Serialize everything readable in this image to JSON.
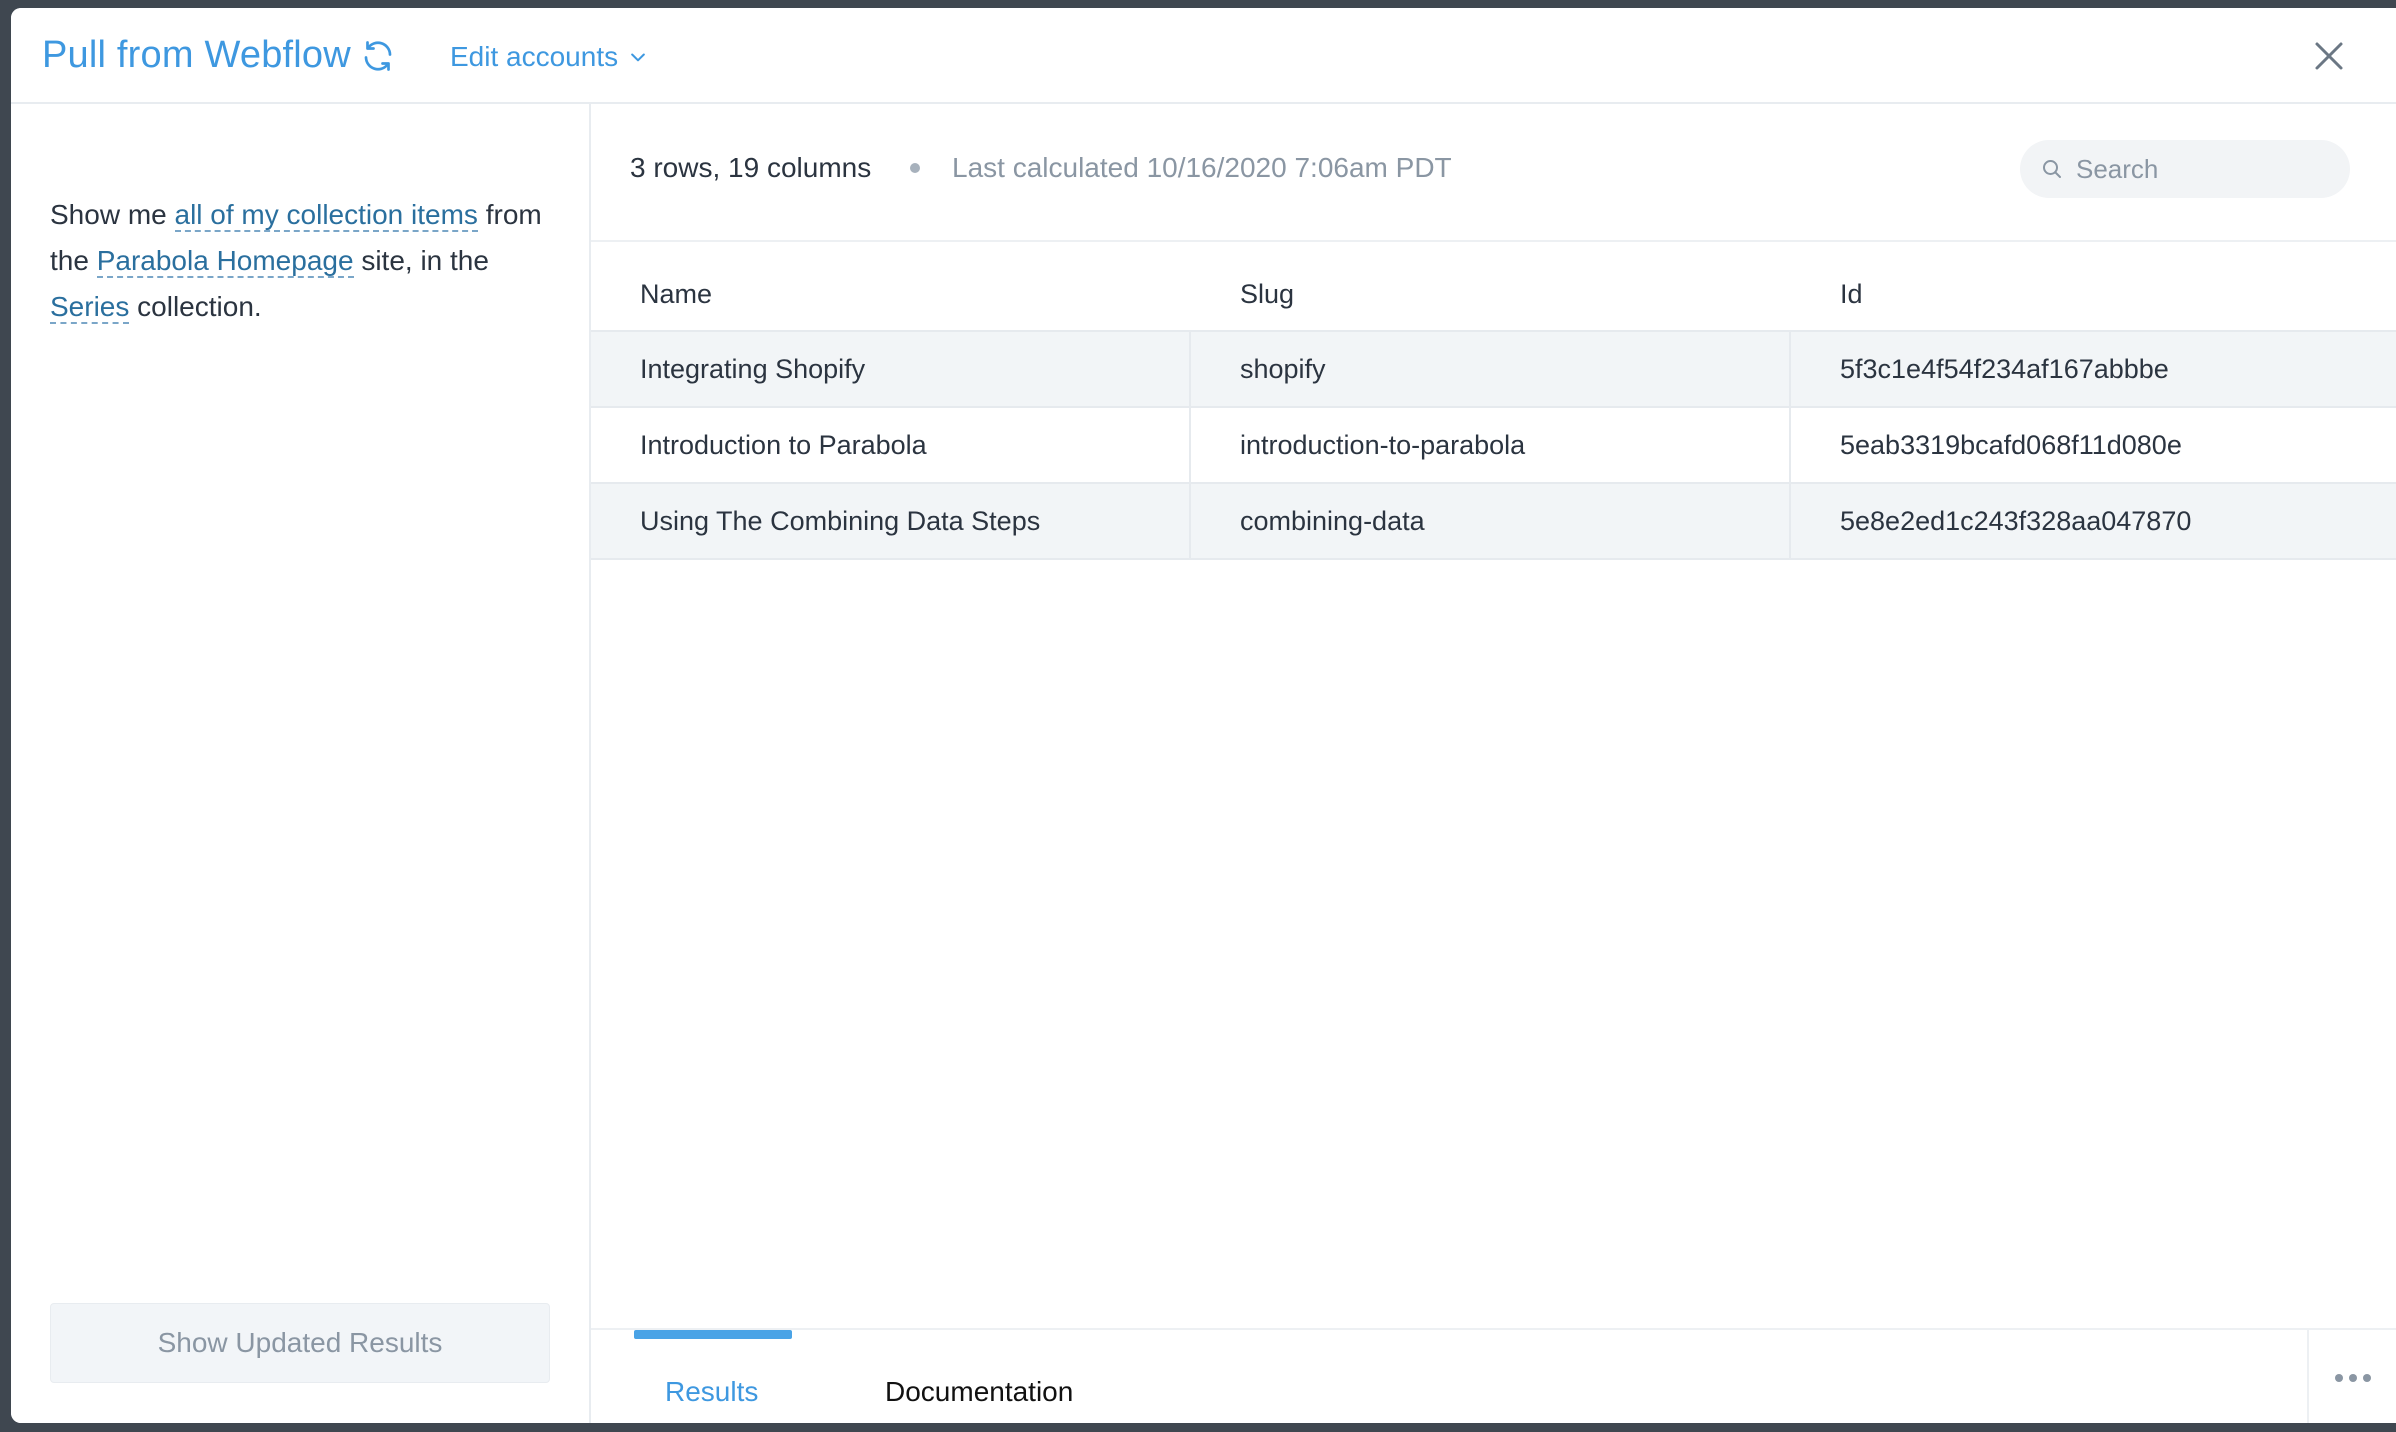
{
  "header": {
    "title": "Pull from Webflow",
    "edit_accounts_label": "Edit accounts"
  },
  "left": {
    "sentence": {
      "p1": "Show me ",
      "link1": "all of my collection items",
      "p2": " from the ",
      "link2": "Parabola Homepage",
      "p3": " site, in the ",
      "link3": "Series",
      "p4": " collection."
    },
    "show_updated_label": "Show Updated Results"
  },
  "summary": {
    "rows_cols": "3 rows, 19 columns",
    "last_calculated": "Last calculated 10/16/2020 7:06am PDT"
  },
  "search": {
    "placeholder": "Search",
    "value": ""
  },
  "table": {
    "columns": [
      "Name",
      "Slug",
      "Id"
    ],
    "rows": [
      [
        "Integrating Shopify",
        "shopify",
        "5f3c1e4f54f234af167abbbe"
      ],
      [
        "Introduction to Parabola",
        "introduction-to-parabola",
        "5eab3319bcafd068f11d080e"
      ],
      [
        "Using The Combining Data Steps",
        "combining-data",
        "5e8e2ed1c243f328aa047870"
      ]
    ]
  },
  "tabs": [
    {
      "label": "Results",
      "active": true
    },
    {
      "label": "Documentation",
      "active": false
    }
  ],
  "colors": {
    "accent": "#3e98e0",
    "link": "#2a6f9e",
    "text": "#2b3440",
    "muted": "#8a96a3"
  },
  "icons": {
    "refresh": "refresh-icon",
    "chevron": "chevron-down-icon",
    "close": "close-icon",
    "search": "search-icon",
    "more": "more-horizontal-icon"
  }
}
